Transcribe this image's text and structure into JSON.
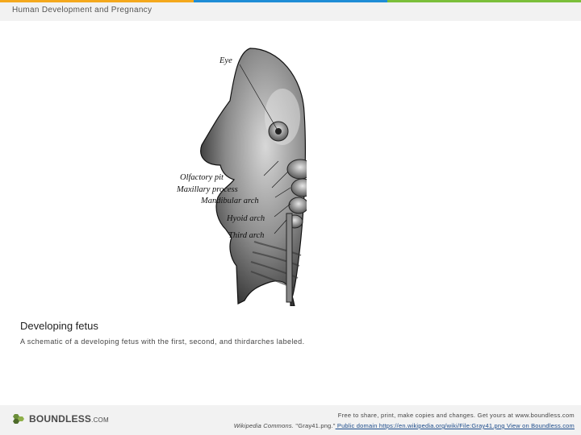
{
  "header": {
    "title": "Human Development and Pregnancy",
    "accent_colors": [
      "#f4a81d",
      "#1f8dd6",
      "#7bbf3a"
    ]
  },
  "figure": {
    "labels": {
      "eye": "Eye",
      "olfactory_pit": "Olfactory pit",
      "maxillary_process": "Maxillary process",
      "mandibular_arch": "Mandibular arch",
      "hyoid_arch": "Hyoid arch",
      "third_arch": "Third arch"
    }
  },
  "caption": {
    "title": "Developing fetus",
    "description": "A schematic of a developing fetus with the first, second, and thirdarches labeled."
  },
  "footer": {
    "logo_text": "BOUNDLESS",
    "logo_suffix": ".COM",
    "line1": "Free to share, print, make copies and changes. Get yours at www.boundless.com",
    "source_prefix": "Wikipedia Commons.",
    "source_title": " \"Gray41.png.\"",
    "link1": " Public domain https://en.wikipedia.org/wiki/File:Gray41.png",
    "link2": " View on Boundless.com"
  }
}
